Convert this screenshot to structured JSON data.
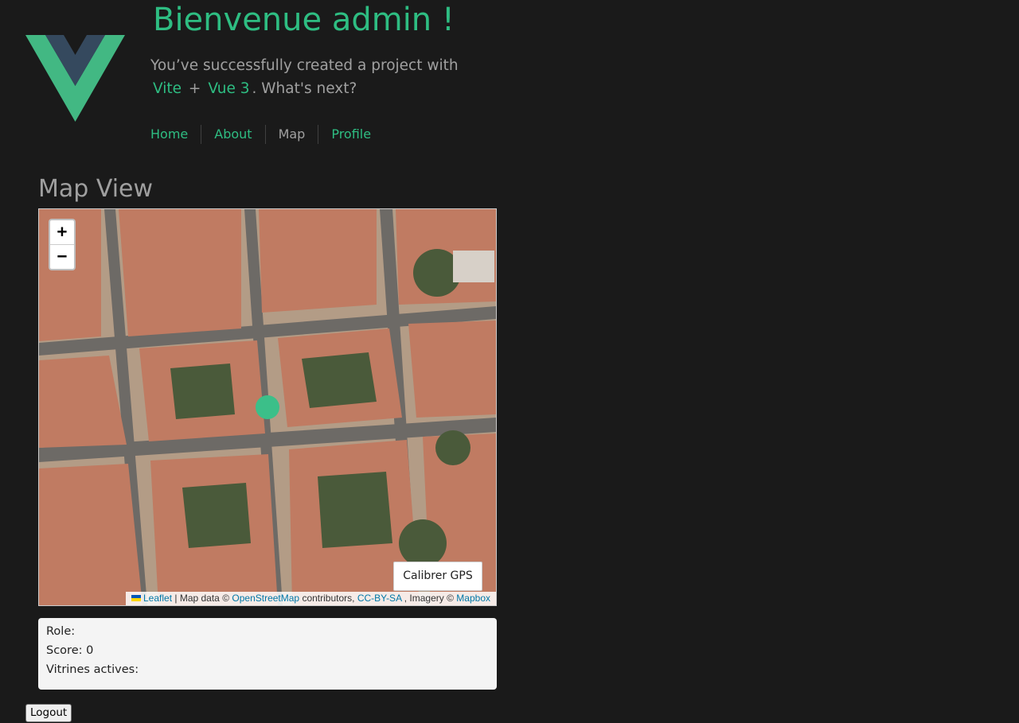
{
  "header": {
    "greeting": "Bienvenue admin !",
    "subtitle_prefix": "You’ve successfully created a project with",
    "link_vite": "Vite",
    "plus": "+",
    "link_vue": "Vue 3",
    "subtitle_suffix": ". What's next?"
  },
  "nav": {
    "items": [
      {
        "label": "Home"
      },
      {
        "label": "About"
      },
      {
        "label": "Map",
        "active": true
      },
      {
        "label": "Profile"
      }
    ]
  },
  "main": {
    "title": "Map View",
    "map": {
      "zoom_in": "+",
      "zoom_out": "−",
      "calibrate_button": "Calibrer GPS",
      "attribution": {
        "leaflet": "Leaflet",
        "map_data": "| Map data ©",
        "osm": "OpenStreetMap",
        "contributors": "contributors,",
        "license": "CC-BY-SA",
        "imagery": ", Imagery ©",
        "mapbox": "Mapbox"
      }
    },
    "info": {
      "role": "Role:",
      "score": "Score: 0",
      "vitrines": "Vitrines actives:"
    }
  },
  "footer": {
    "logout": "Logout"
  },
  "colors": {
    "accent": "#2ebd82",
    "background": "#1a1a1a",
    "marker": "#3bbf89"
  }
}
